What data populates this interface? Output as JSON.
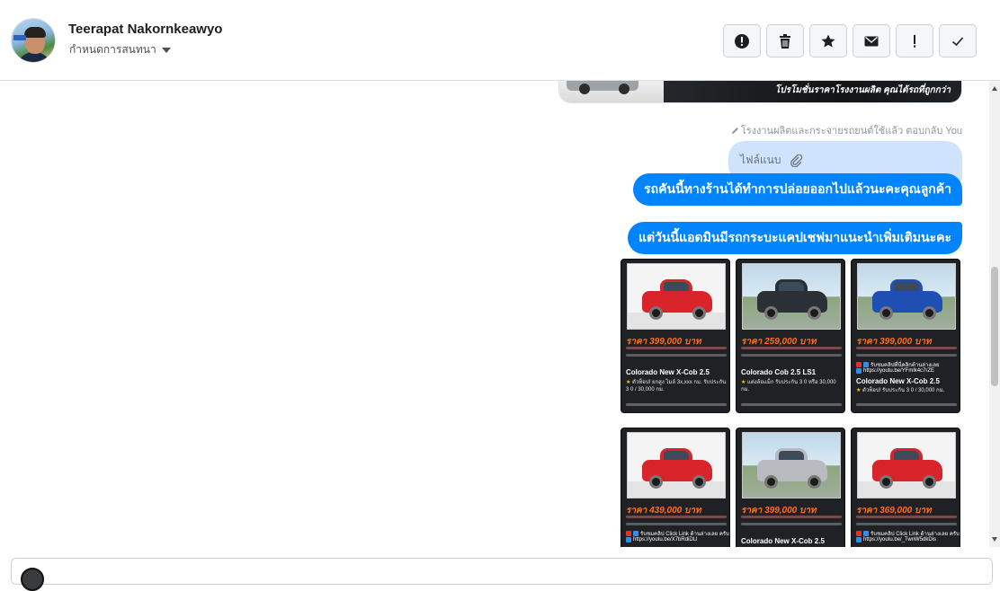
{
  "header": {
    "contact_name": "Teerapat Nakornkeawyo",
    "conversation_settings": "กำหนดการสนทนา",
    "actions": [
      {
        "name": "report-spam-button",
        "icon": "alert-circle-icon"
      },
      {
        "name": "delete-button",
        "icon": "trash-icon"
      },
      {
        "name": "star-button",
        "icon": "star-icon"
      },
      {
        "name": "mark-unread-button",
        "icon": "envelope-icon"
      },
      {
        "name": "important-button",
        "icon": "exclamation-icon"
      },
      {
        "name": "mark-done-button",
        "icon": "checkmark-icon"
      }
    ]
  },
  "thread": {
    "promo_banner_text": "โปรโมชั่นราคาโรงงานผลิต คุณได้รถที่ถูกกว่า",
    "reply_note": "โรงงานผลิตและกระจายรถยนต์ใช้แล้ว ตอบกลับ You",
    "attachment_label": "ไฟล์แนบ",
    "messages": [
      "รถคันนี้ทางร้านได้ทำการปล่อยออกไปแล้วนะคะคุณลูกค้า",
      "แต่วันนี้แอดมินมีรถกระบะแคปเชฟมาแนะนำเพิ่มเติมนะคะ"
    ],
    "products": [
      {
        "price": "ราคา 399,000 บาท",
        "model": "Colorado New X-Cob 2.5",
        "desc": "ตัวท็อป! ยกสูง ไมล์ 3x,xxx กม. รับประกัน 3 0 / 30,000 กม.",
        "color": "#d8232a",
        "outdoor": false,
        "has_link": false
      },
      {
        "price": "ราคา 259,000 บาท",
        "model": "Colorado Cob 2.5 LS1",
        "desc": "แต่งล้อแม็ก รับประกัน 3 0 หรือ 30,000 กม.",
        "color": "#2b2f36",
        "outdoor": true,
        "has_link": false
      },
      {
        "price": "ราคา 399,000 บาท",
        "model": "Colorado New X-Cob 2.5",
        "desc": "ตัวท็อป! รับประกัน 3 0 / 30,000 กม.",
        "color": "#1f4fb3",
        "outdoor": true,
        "has_link": true,
        "link_caption": "รับชมคลิปที่นี่คลิกด้านล่างเลย",
        "link": "https://youtu.be/YFmlk4c7rZE"
      },
      {
        "price": "ราคา 439,000 บาท",
        "model": "",
        "desc": "",
        "color": "#d8232a",
        "outdoor": false,
        "has_link": true,
        "link_caption": "รับชมคลิป Click Link ด้านล่างเลย ครับ",
        "link": "https://youtu.be/X7bRdiDLl"
      },
      {
        "price": "ราคา 399,000 บาท",
        "model": "Colorado New X-Cob 2.5",
        "desc": "",
        "color": "#b8bcc1",
        "outdoor": true,
        "has_link": false
      },
      {
        "price": "ราคา 369,000 บาท",
        "model": "",
        "desc": "",
        "color": "#d8232a",
        "outdoor": false,
        "has_link": true,
        "link_caption": "รับชมคลิป Click Link ด้านล่างเลย ครับ",
        "link": "https://youtu.be/_TwnW5dkDis"
      }
    ]
  }
}
